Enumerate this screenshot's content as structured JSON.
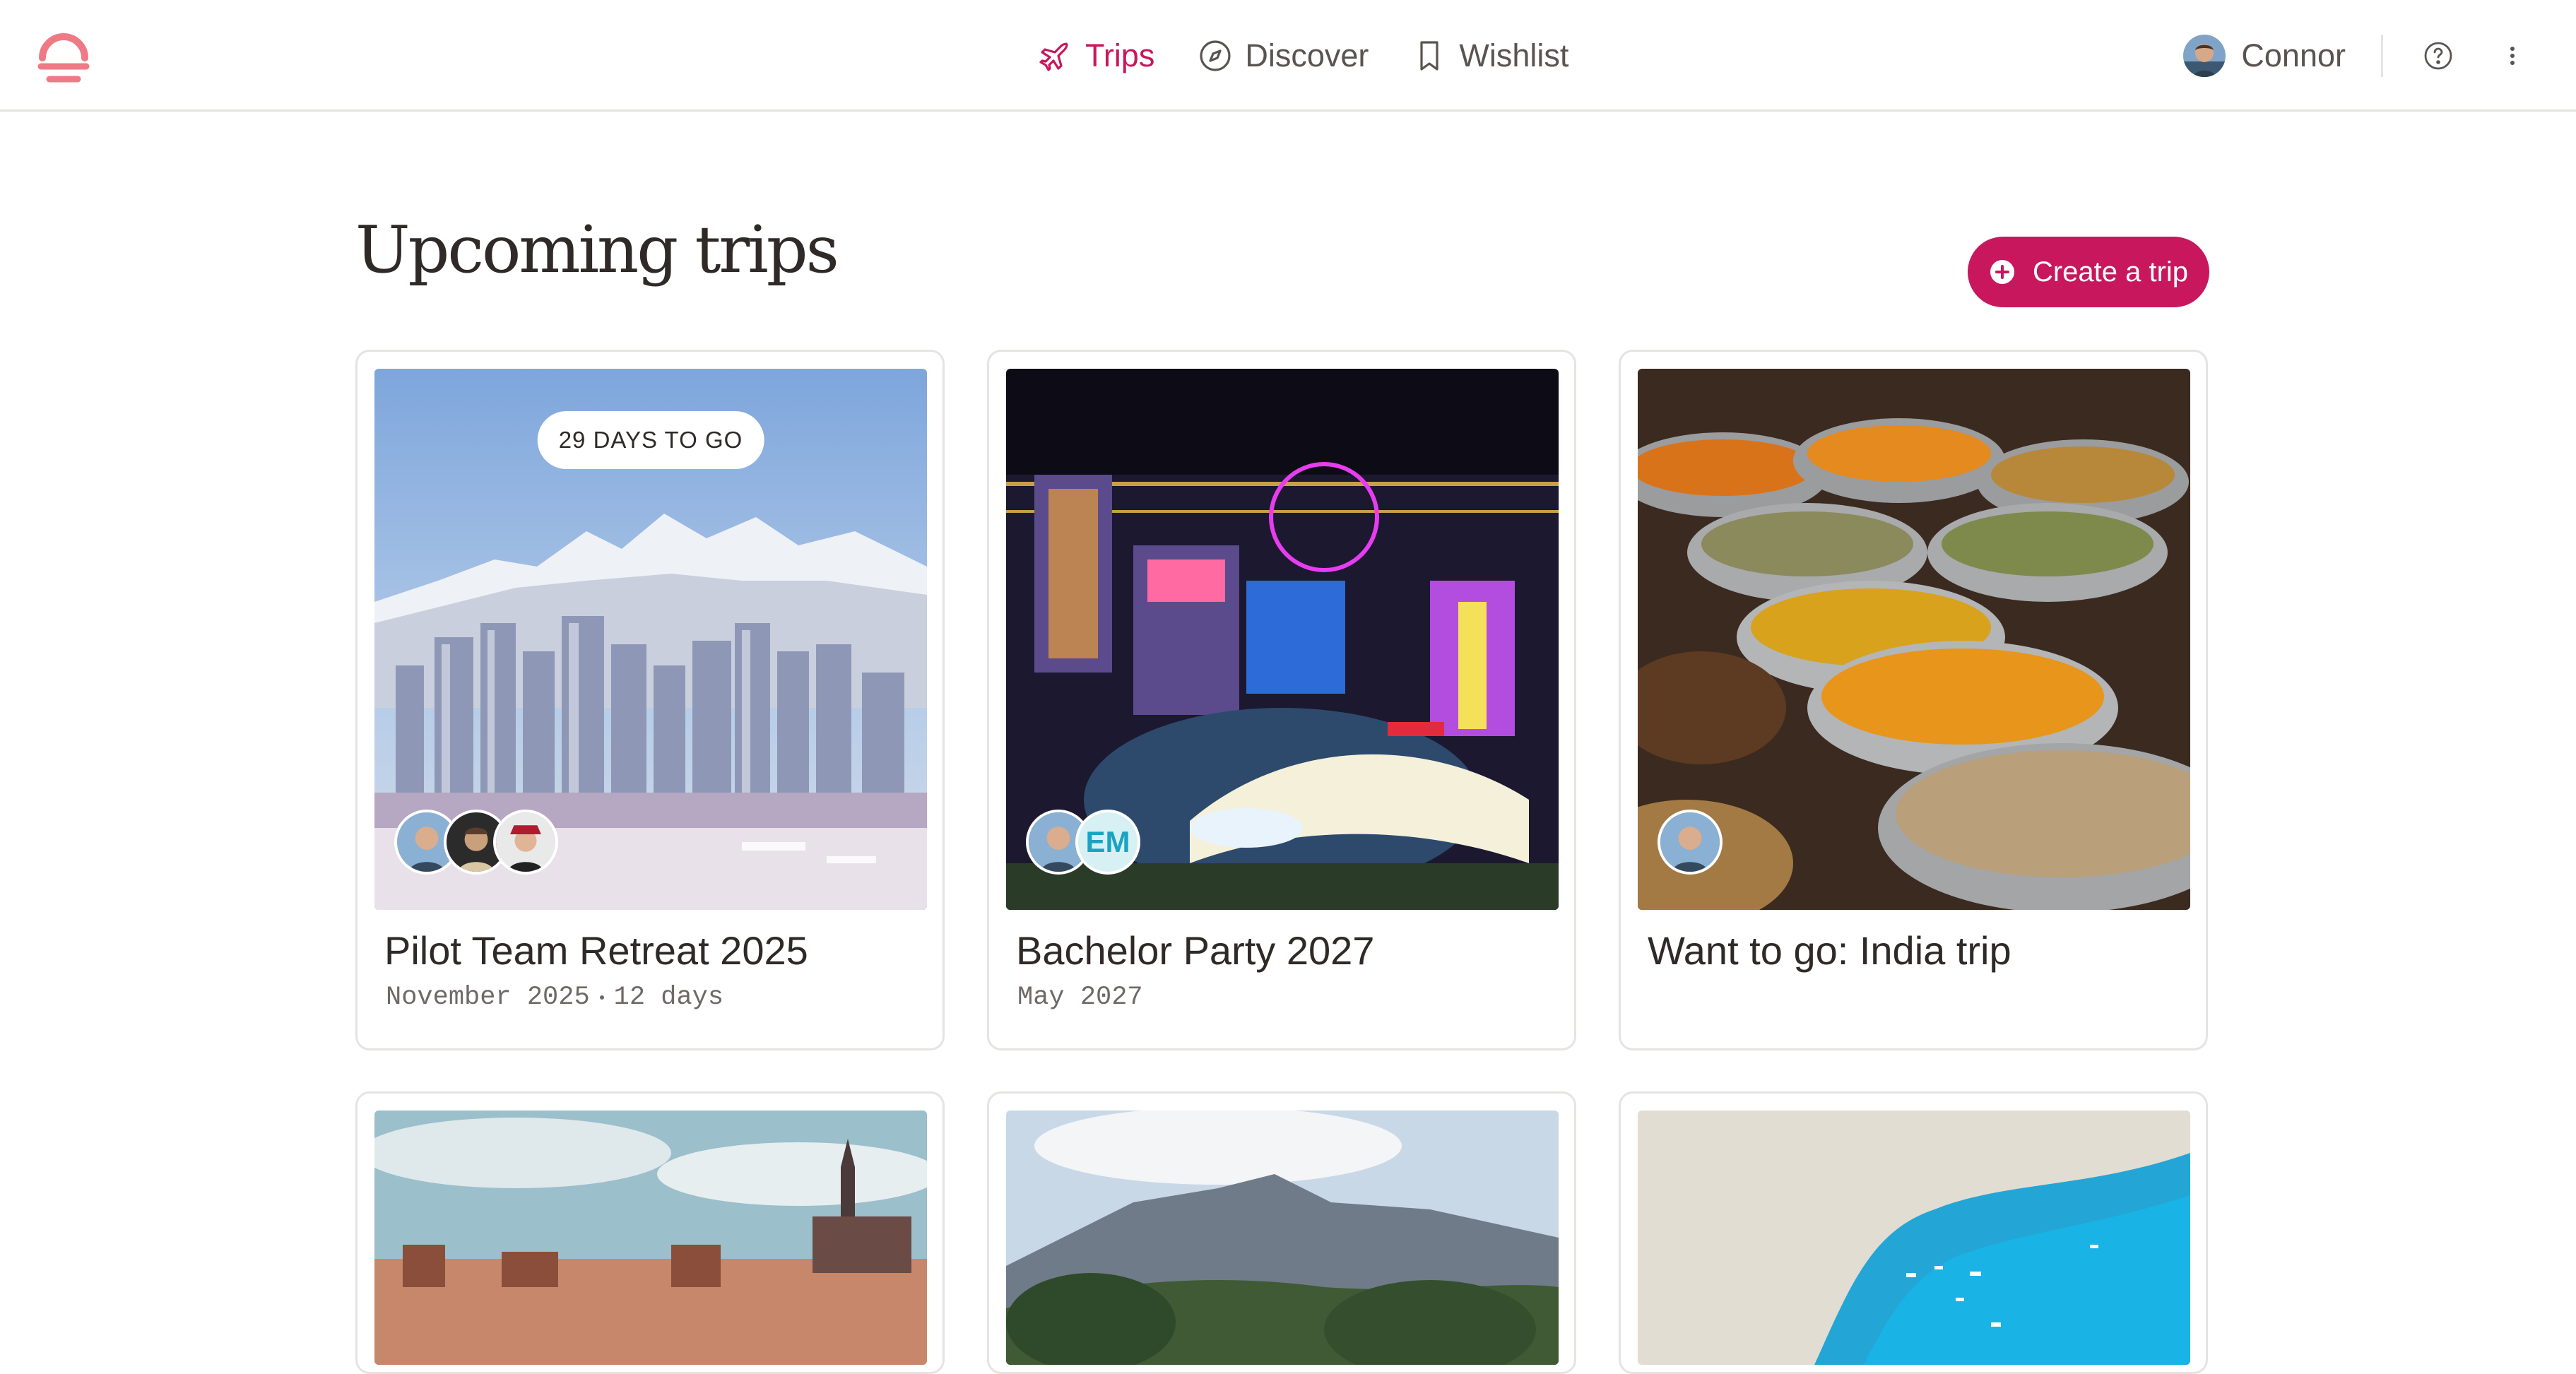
{
  "nav": {
    "items": [
      {
        "label": "Trips",
        "icon": "plane-icon",
        "active": true
      },
      {
        "label": "Discover",
        "icon": "compass-icon",
        "active": false
      },
      {
        "label": "Wishlist",
        "icon": "bookmark-icon",
        "active": false
      }
    ],
    "user_name": "Connor",
    "help_icon": "help-circle-icon",
    "more_icon": "more-vertical-icon"
  },
  "page": {
    "title": "Upcoming trips",
    "create_label": "Create a trip"
  },
  "colors": {
    "accent": "#c8175d",
    "logo": "#ee7a86"
  },
  "trips": [
    {
      "title": "Pilot Team Retreat 2025",
      "date": "November 2025",
      "duration": "12 days",
      "badge": "29 DAYS TO GO",
      "image": "vancouver-snowy-mountains-city",
      "travelers": 3
    },
    {
      "title": "Bachelor Party 2027",
      "date": "May 2027",
      "image": "las-vegas-night-fountains",
      "travelers": 2,
      "initials": "EM"
    },
    {
      "title": "Want to go: India trip",
      "image": "spice-market-bowls",
      "travelers": 1
    },
    {
      "image": "prague-skyline"
    },
    {
      "image": "mountain-valley-trees"
    },
    {
      "image": "cliff-turquoise-sea"
    }
  ]
}
